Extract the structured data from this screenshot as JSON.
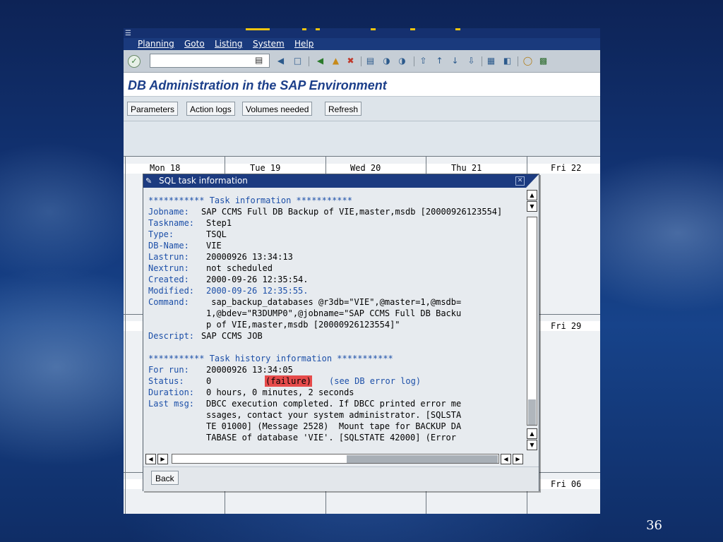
{
  "menu": {
    "items": [
      "Planning",
      "Goto",
      "Listing",
      "System",
      "Help"
    ]
  },
  "toolbar": {
    "command_value": "",
    "icons": [
      "enter-icon",
      "back-icon",
      "save-icon",
      "back-nav-icon",
      "exit-icon",
      "cancel-icon",
      "print-icon",
      "find-icon",
      "find-next-icon",
      "first-page-icon",
      "prev-page-icon",
      "next-page-icon",
      "last-page-icon",
      "new-session-icon",
      "shortcut-icon",
      "help-icon",
      "layout-icon"
    ]
  },
  "page": {
    "title": "DB Administration in the SAP Environment"
  },
  "app_buttons": [
    "Parameters",
    "Action logs",
    "Volumes needed",
    "Refresh"
  ],
  "calendar": {
    "week1": [
      "Mon 18",
      "Tue 19",
      "Wed 20",
      "Thu 21",
      "Fri 22"
    ],
    "fri2": "Fri 29",
    "fri3": "Fri 06"
  },
  "dialog": {
    "title": "SQL task information",
    "header1": "*********** Task information ***********",
    "job": {
      "jobname_label": "Jobname:",
      "jobname": "SAP CCMS Full DB Backup of VIE,master,msdb [20000926123554]",
      "taskname_label": "Taskname:",
      "taskname": "Step1",
      "type_label": "Type:",
      "type": "TSQL",
      "dbname_label": "DB-Name:",
      "dbname": "VIE",
      "lastrun_label": "Lastrun:",
      "lastrun": "20000926 13:34:13",
      "nextrun_label": "Nextrun:",
      "nextrun": "not scheduled",
      "created_label": "Created:",
      "created": "2000-09-26 12:35:54.",
      "modified_label": "Modified:",
      "modified": "2000-09-26 12:35:55.",
      "command_label": "Command:",
      "command1": " sap_backup_databases @r3db=\"VIE\",@master=1,@msdb=",
      "command2": "1,@bdev=\"R3DUMP0\",@jobname=\"SAP CCMS Full DB Backu",
      "command3": "p of VIE,master,msdb [20000926123554]\"",
      "descript_label": "Descript:",
      "descript": "SAP CCMS JOB"
    },
    "header2": "*********** Task history information ***********",
    "history": {
      "forrun_label": "For run:",
      "forrun": "20000926 13:34:05",
      "status_label": "Status:",
      "status_code": "0",
      "status_text": "(failure)",
      "status_link": "(see DB error log)",
      "duration_label": "Duration:",
      "duration": "0 hours, 0 minutes, 2 seconds",
      "lastmsg_label": "Last msg:",
      "msg1": "DBCC execution completed. If DBCC printed error me",
      "msg2": "ssages, contact your system administrator. [SQLSTA",
      "msg3": "TE 01000] (Message 2528)  Mount tape for BACKUP DA",
      "msg4": "TABASE of database 'VIE'. [SQLSTATE 42000] (Error"
    },
    "back_label": "Back"
  },
  "slide_number": "36"
}
